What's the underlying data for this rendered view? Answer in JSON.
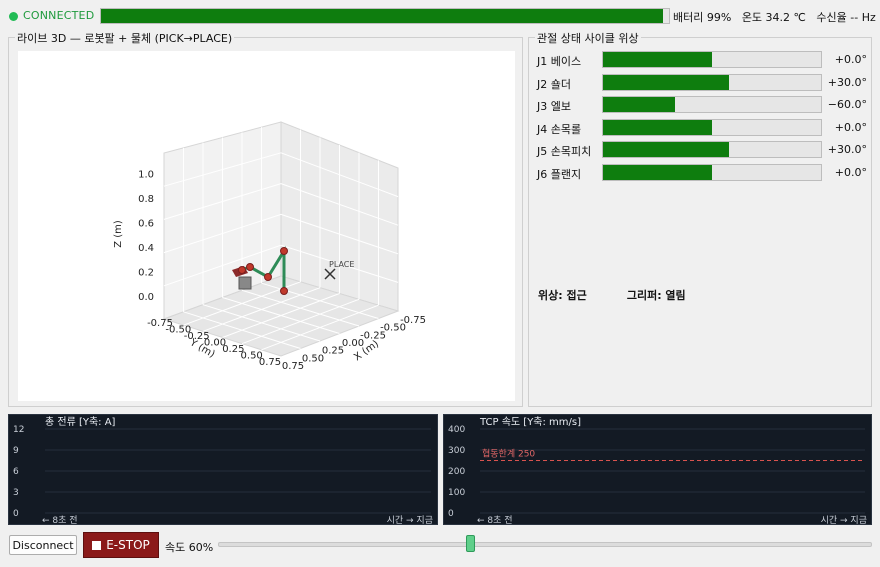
{
  "status": {
    "connection": "CONNECTED",
    "top_progress": 0.99,
    "battery": "배터리 99%",
    "temperature": "온도 34.2 ℃",
    "rx_rate": "수신율 -- Hz"
  },
  "plot3d": {
    "title": "라이브 3D — 로봇팔 + 물체 (PICK→PLACE)",
    "z_label": "Z (m)",
    "x_label": "X (m)",
    "y_label": "Y (m)",
    "z_ticks": [
      "0.0",
      "0.2",
      "0.4",
      "0.6",
      "0.8",
      "1.0"
    ],
    "x_ticks": [
      "0.75",
      "0.50",
      "0.25",
      "0.00",
      "-0.25",
      "-0.50",
      "-0.75"
    ],
    "y_ticks": [
      "-0.75",
      "-0.50",
      "-0.25",
      "0.00",
      "0.25",
      "0.50",
      "0.75"
    ],
    "place_label": "PLACE"
  },
  "joints": {
    "title": "관절 상태  사이클 위상",
    "items": [
      {
        "label": "J1 베이스",
        "value": "+0.0°",
        "fill": 0.5
      },
      {
        "label": "J2 숄더",
        "value": "+30.0°",
        "fill": 0.58
      },
      {
        "label": "J3 엘보",
        "value": "−60.0°",
        "fill": 0.33
      },
      {
        "label": "J4 손목롤",
        "value": "+0.0°",
        "fill": 0.5
      },
      {
        "label": "J5 손목피치",
        "value": "+30.0°",
        "fill": 0.58
      },
      {
        "label": "J6 플랜지",
        "value": "+0.0°",
        "fill": 0.5
      }
    ],
    "phase": "위상: 접근",
    "gripper": "그리퍼: 열림"
  },
  "current_chart": {
    "title": "총 전류  [Y축: A]",
    "ylim": [
      0,
      12
    ],
    "yticks": [
      "12",
      "9",
      "6",
      "3",
      "0"
    ],
    "x_left": "← 8초 전",
    "x_right": "시간 → 지금"
  },
  "speed_chart": {
    "title": "TCP 속도  [Y축: mm/s]",
    "ylim": [
      0,
      400
    ],
    "yticks": [
      "400",
      "300",
      "200",
      "100",
      "0"
    ],
    "limit_value": 250,
    "limit_label": "협동한계 250",
    "x_left": "← 8초 전",
    "x_right": "시간 → 지금"
  },
  "controls": {
    "disconnect_label": "Disconnect",
    "estop_label": "E-STOP",
    "speed_label": "속도 60%",
    "speed_value": 0.6
  },
  "colors": {
    "bar_fill": "#0e7d0e",
    "estop": "#8b1a1a",
    "arm_link": "#2e8b57",
    "joint_marker": "#c0392b"
  }
}
